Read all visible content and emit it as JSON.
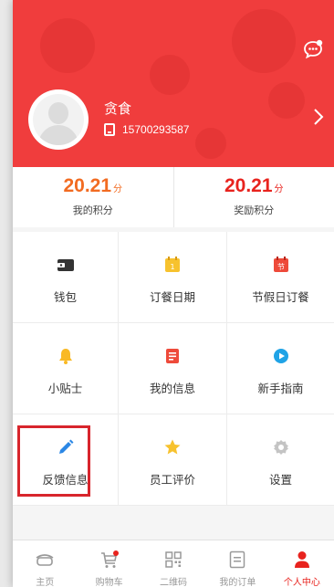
{
  "profile": {
    "name": "贪食",
    "phone": "15700293587",
    "chat_icon": "chat-bubble-icon",
    "arrow_icon": "chevron-right-icon"
  },
  "points": [
    {
      "value": "20.21",
      "unit": "分",
      "label": "我的积分"
    },
    {
      "value": "20.21",
      "unit": "分",
      "label": "奖励积分"
    }
  ],
  "menu": [
    {
      "label": "钱包",
      "icon": "wallet-icon",
      "color": "#333333"
    },
    {
      "label": "订餐日期",
      "icon": "calendar-icon",
      "color": "#f7c22e",
      "badge": "1"
    },
    {
      "label": "节假日订餐",
      "icon": "holiday-calendar-icon",
      "color": "#ee4a3a",
      "badge": "节"
    },
    {
      "label": "小贴士",
      "icon": "bell-icon",
      "color": "#f9b924"
    },
    {
      "label": "我的信息",
      "icon": "info-document-icon",
      "color": "#ee4a3a"
    },
    {
      "label": "新手指南",
      "icon": "guide-play-icon",
      "color": "#1fa3e6"
    },
    {
      "label": "反馈信息",
      "icon": "pencil-icon",
      "color": "#2b87e5"
    },
    {
      "label": "员工评价",
      "icon": "star-icon",
      "color": "#f7c22e"
    },
    {
      "label": "设置",
      "icon": "gear-icon",
      "color": "#bdbdbd"
    }
  ],
  "tabs": [
    {
      "label": "主页",
      "icon": "home-icon"
    },
    {
      "label": "购物车",
      "icon": "cart-icon"
    },
    {
      "label": "二维码",
      "icon": "qr-code-icon"
    },
    {
      "label": "我的订单",
      "icon": "order-list-icon"
    },
    {
      "label": "个人中心",
      "icon": "person-icon",
      "active": true
    }
  ],
  "colors": {
    "header": "#f03d3d",
    "accent": "#e8231e",
    "points_orange": "#f26b21",
    "highlight_border": "#d8252c"
  }
}
